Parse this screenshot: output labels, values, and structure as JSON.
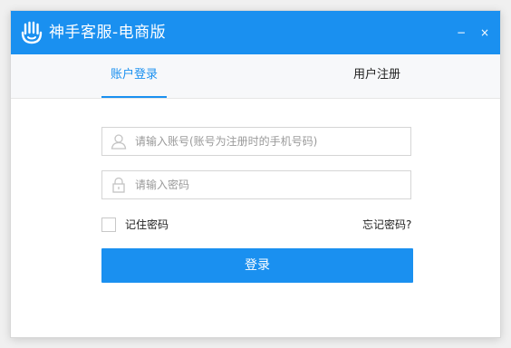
{
  "app": {
    "title": "神手客服-电商版",
    "accent_color": "#1a90f0",
    "logo_icon": "hand-logo-icon",
    "window_controls": {
      "minimize": "−",
      "close": "×"
    }
  },
  "tabs": [
    {
      "label": "账户登录",
      "active": true
    },
    {
      "label": "用户注册",
      "active": false
    }
  ],
  "form": {
    "account": {
      "icon": "user-icon",
      "value": "",
      "placeholder": "请输入账号(账号为注册时的手机号码)"
    },
    "password": {
      "icon": "lock-icon",
      "value": "",
      "placeholder": "请输入密码"
    },
    "remember": {
      "label": "记住密码",
      "checked": false
    },
    "forgot_label": "忘记密码?",
    "login_label": "登录"
  }
}
